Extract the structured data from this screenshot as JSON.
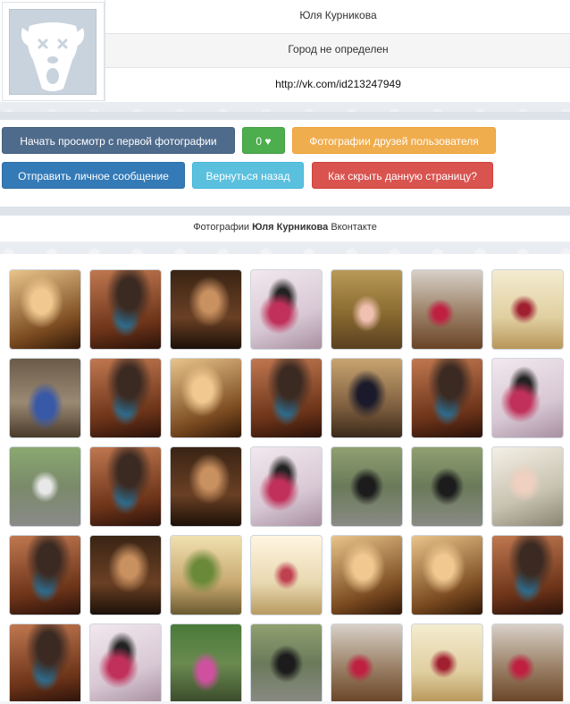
{
  "profile": {
    "name": "Юля Курникова",
    "city": "Город не определен",
    "url": "http://vk.com/id213247949"
  },
  "buttons": {
    "start_view": "Начать просмотр с первой фотографии",
    "like": "0 ♥",
    "friends_photos": "Фотографии друзей пользователя",
    "send_message": "Отправить личное сообщение",
    "go_back": "Вернуться назад",
    "hide_page": "Как скрыть данную страницу?"
  },
  "caption": {
    "prefix": "Фотографии",
    "name": "Юля Курникова",
    "suffix": "Вконтакте"
  },
  "colors": {
    "start": "#4f6b8c",
    "like": "#4cae4c",
    "friends": "#f0ad4e",
    "message": "#337ab7",
    "back": "#5bc0de",
    "hide": "#d9534f"
  },
  "gallery": {
    "columns": 7,
    "rows": 5,
    "photo_count": 35
  }
}
